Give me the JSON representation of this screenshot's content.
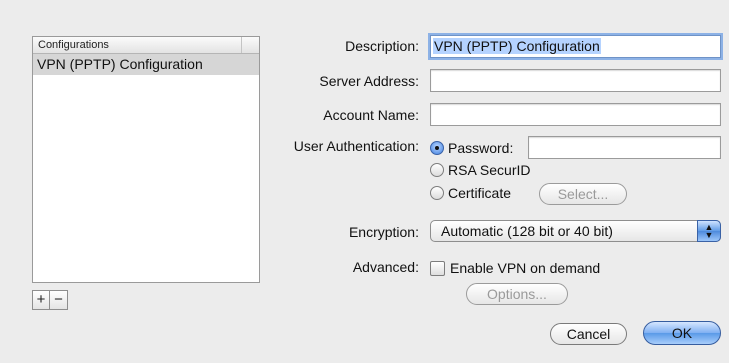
{
  "configurations": {
    "header": "Configurations",
    "items": [
      "VPN (PPTP) Configuration"
    ]
  },
  "list_buttons": {
    "add": "+",
    "remove": "−"
  },
  "form": {
    "description_label": "Description:",
    "description_value": "VPN (PPTP) Configuration",
    "server_label": "Server Address:",
    "server_value": "",
    "account_label": "Account Name:",
    "account_value": "",
    "auth_label": "User Authentication:",
    "auth_options": [
      {
        "label": "Password:",
        "selected": true
      },
      {
        "label": "RSA SecurID",
        "selected": false
      },
      {
        "label": "Certificate",
        "selected": false
      }
    ],
    "select_button": "Select...",
    "encryption_label": "Encryption:",
    "encryption_value": "Automatic (128 bit or 40 bit)",
    "advanced_label": "Advanced:",
    "vpn_on_demand_label": "Enable VPN on demand",
    "vpn_on_demand_checked": false,
    "options_button": "Options..."
  },
  "actions": {
    "cancel": "Cancel",
    "ok": "OK"
  },
  "colors": {
    "focus_ring": "#8db2e6",
    "default_button": "#5a9ae8",
    "selection": "#b5d3ff"
  }
}
